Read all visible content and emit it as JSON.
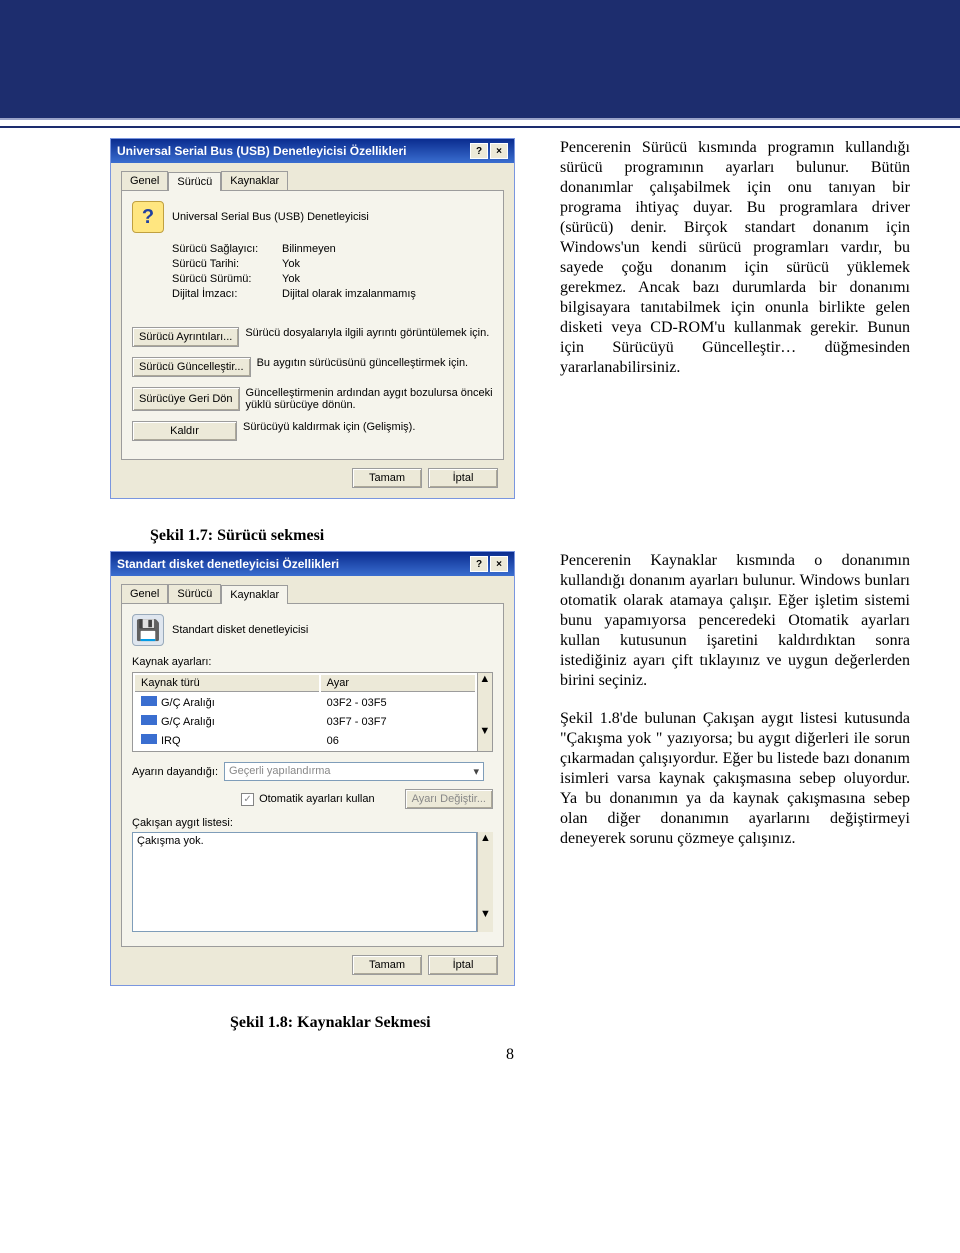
{
  "header": {},
  "dialog1": {
    "title": "Universal Serial Bus (USB) Denetleyicisi Özellikleri",
    "helpGlyph": "?",
    "closeGlyph": "×",
    "tabs": {
      "genel": "Genel",
      "surucu": "Sürücü",
      "kaynaklar": "Kaynaklar"
    },
    "device_icon": "?",
    "device_name": "Universal Serial Bus (USB) Denetleyicisi",
    "props": {
      "k1": "Sürücü Sağlayıcı:",
      "v1": "Bilinmeyen",
      "k2": "Sürücü Tarihi:",
      "v2": "Yok",
      "k3": "Sürücü Sürümü:",
      "v3": "Yok",
      "k4": "Dijital İmzacı:",
      "v4": "Dijital olarak imzalanmamış"
    },
    "btns": {
      "details": "Sürücü Ayrıntıları...",
      "details_desc": "Sürücü dosyalarıyla ilgili ayrıntı görüntülemek için.",
      "update": "Sürücü Güncelleştir...",
      "update_desc": "Bu aygıtın sürücüsünü güncelleştirmek için.",
      "rollback": "Sürücüye Geri Dön",
      "rollback_desc": "Güncelleştirmenin ardından aygıt bozulursa önceki yüklü sürücüye dönün.",
      "remove": "Kaldır",
      "remove_desc": "Sürücüyü kaldırmak için (Gelişmiş).",
      "ok": "Tamam",
      "cancel": "İptal"
    }
  },
  "para1": "Pencerenin Sürücü kısmında programın kullandığı sürücü programının ayarları bulunur. Bütün donanımlar çalışabilmek için onu tanıyan bir programa ihtiyaç duyar. Bu programlara driver (sürücü) denir. Birçok standart donanım için Windows'un kendi sürücü programları vardır, bu sayede çoğu donanım için sürücü yüklemek gerekmez. Ancak bazı durumlarda bir donanımı bilgisayara tanıtabilmek için onunla birlikte gelen disketi veya CD-ROM'u kullanmak gerekir. Bunun için Sürücüyü Güncelleştir… düğmesinden yararlanabilirsiniz.",
  "caption1": "Şekil 1.7: Sürücü sekmesi",
  "dialog2": {
    "title": "Standart disket denetleyicisi Özellikleri",
    "tabs": {
      "genel": "Genel",
      "surucu": "Sürücü",
      "kaynaklar": "Kaynaklar"
    },
    "device_name": "Standart disket denetleyicisi",
    "res_label": "Kaynak ayarları:",
    "cols": {
      "type": "Kaynak türü",
      "setting": "Ayar"
    },
    "rows": [
      {
        "type": "G/Ç Aralığı",
        "setting": "03F2 - 03F5"
      },
      {
        "type": "G/Ç Aralığı",
        "setting": "03F7 - 03F7"
      },
      {
        "type": "IRQ",
        "setting": "06"
      }
    ],
    "based_on_label": "Ayarın dayandığı:",
    "based_on_value": "Geçerli yapılandırma",
    "auto_chk": "Otomatik ayarları kullan",
    "change_btn": "Ayarı Değiştir...",
    "conflict_label": "Çakışan aygıt listesi:",
    "conflict_value": "Çakışma yok.",
    "ok": "Tamam",
    "cancel": "İptal"
  },
  "para2": "Pencerenin Kaynaklar kısmında o donanımın kullandığı donanım ayarları bulunur. Windows bunları otomatik olarak atamaya çalışır. Eğer işletim sistemi bunu yapamıyorsa penceredeki Otomatik ayarları kullan kutusunun işaretini kaldırdıktan sonra istediğiniz ayarı çift tıklayınız ve uygun değerlerden birini seçiniz.",
  "para3": "Şekil 1.8'de bulunan Çakışan aygıt listesi kutusunda \"Çakışma yok \" yazıyorsa; bu aygıt diğerleri ile sorun çıkarmadan çalışıyordur. Eğer bu listede bazı donanım isimleri varsa kaynak çakışmasına sebep oluyordur. Ya bu donanımın ya da kaynak çakışmasına sebep olan diğer donanımın ayarlarını değiştirmeyi deneyerek sorunu çözmeye çalışınız.",
  "caption2": "Şekil 1.8: Kaynaklar Sekmesi",
  "page_number": "8"
}
